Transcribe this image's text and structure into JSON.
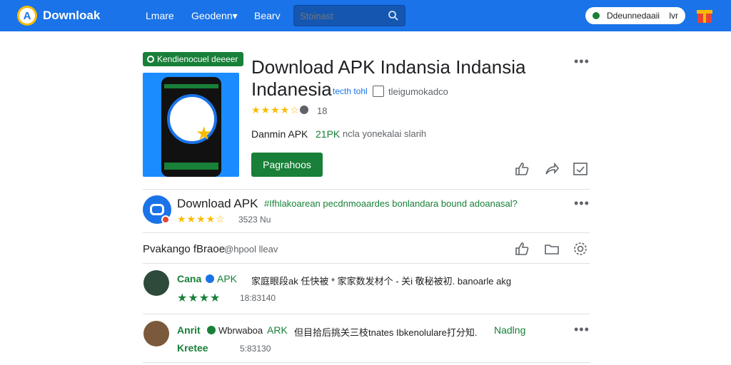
{
  "header": {
    "brand": "Downloak",
    "nav": [
      "Lmare",
      "Geodenn▾",
      "Bearv"
    ],
    "search_placeholder": "Stoinast",
    "status_pill": {
      "text": "Ddeunnedaaii",
      "lang": "lvr"
    }
  },
  "app": {
    "badge": "Kendienocuel deeeer",
    "title_line1": "Download APK Indansia Indansia",
    "title_line2": "Indanesia",
    "dev_link": "tecth tohl",
    "tag_text": "tleigumokadco",
    "rating_stars": "★★★★☆",
    "rating_count": "18",
    "meta_label": "Danmin APK",
    "meta_size": "21PK",
    "meta_desc": "ncla yonekalai slarih",
    "install_label": "Pagrahoos"
  },
  "developer": {
    "name": "Download APK",
    "desc": "#Ifhlakoarean pecdnmoaardes bonlandara bound adoanasal?",
    "rating_stars": "★★★★☆",
    "rating_count": "3523 Nu"
  },
  "reviews_header": {
    "title": "Pvakango fBraoe",
    "subtitle": "@hpool lleav"
  },
  "reviews": [
    {
      "name": "Cana",
      "tag": "APK",
      "text": "家庭眼段ak 任快被 * 家家数发材个 - 关i 敬秘被初.  banoarle akg",
      "stars": "★★★★",
      "date": "18:83140"
    },
    {
      "name": "Anrit",
      "tag": "Wbrwaboa",
      "tag2": "ARK",
      "text": "但目拾后挑关三枝tnates Ibkenolulare打分知.",
      "highlight": "Nadlng",
      "stars": "Kretee",
      "date": "5:83130"
    }
  ],
  "colors": {
    "primary": "#1a73e8",
    "accent_green": "#188038",
    "star": "#fbbc04"
  }
}
